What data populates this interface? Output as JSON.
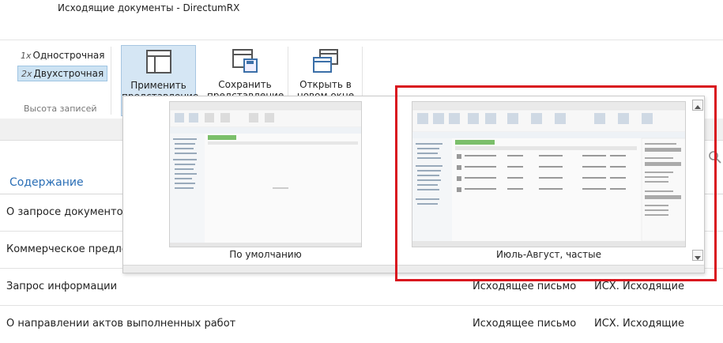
{
  "window": {
    "title": "Исходящие документы - DirectumRX"
  },
  "ribbon": {
    "row_height": {
      "options": [
        {
          "prefix": "1x",
          "label": "Однострочная",
          "selected": false
        },
        {
          "prefix": "2x",
          "label": "Двухстрочная",
          "selected": true
        }
      ],
      "caption": "Высота записей"
    },
    "apply_view": {
      "line1": "Применить",
      "line2": "представление ▾"
    },
    "save_view": {
      "line1": "Сохранить",
      "line2": "представление"
    },
    "open_new_window": {
      "line1": "Открыть в",
      "line2": "новом окне"
    }
  },
  "list": {
    "column_header": "Содержание",
    "rows": [
      {
        "content": "О запросе документов",
        "type": "",
        "register": ""
      },
      {
        "content": "Коммерческое предлож",
        "type": "",
        "register": ""
      },
      {
        "content": "Запрос информации",
        "type": "Исходящее письмо",
        "register": "ИСХ. Исходящие"
      },
      {
        "content": "О направлении актов выполненных работ",
        "type": "Исходящее письмо",
        "register": "ИСХ. Исходящие"
      }
    ]
  },
  "views_popup": {
    "views": [
      {
        "label": "По умолчанию"
      },
      {
        "label": "Июль-Август, частые"
      }
    ]
  },
  "colors": {
    "accent": "#2b6fb6",
    "highlight": "#d9161f",
    "selected": "#cde3f3"
  }
}
